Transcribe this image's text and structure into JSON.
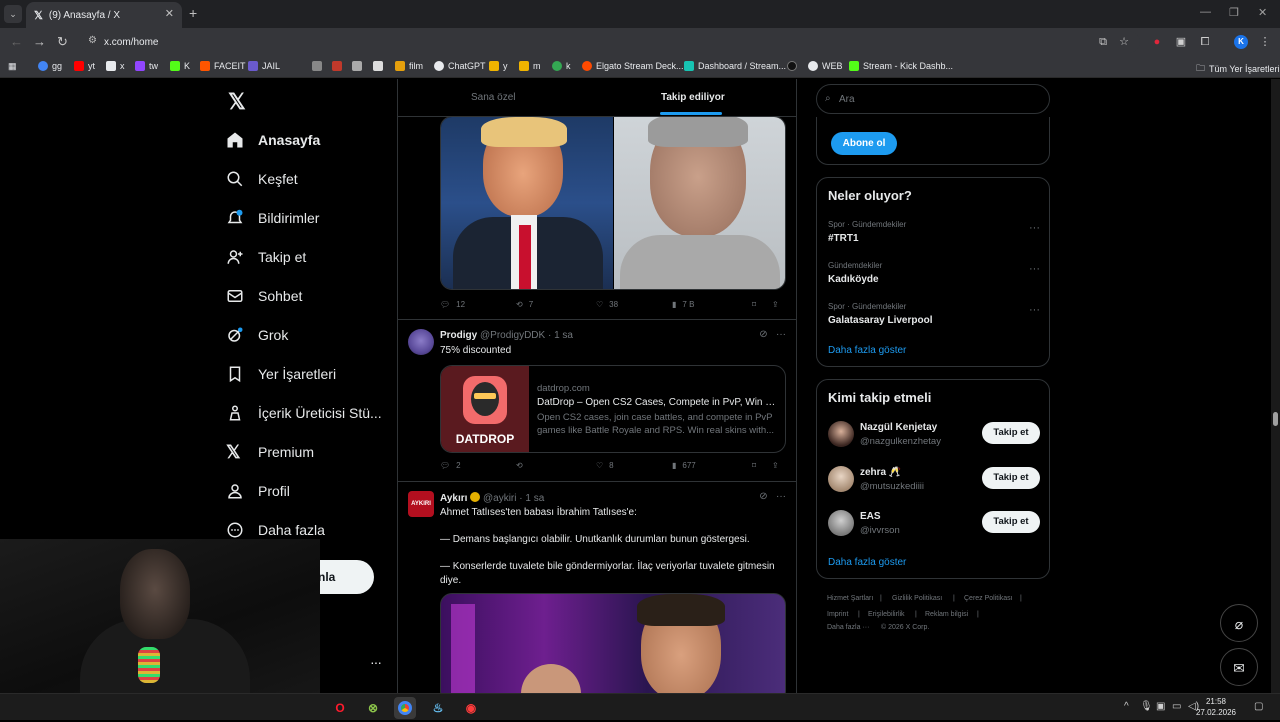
{
  "browser": {
    "tab_title": "(9) Anasayfa / X",
    "url": "x.com/home",
    "bookmarks": [
      {
        "label": "gg",
        "color": "#4285f4"
      },
      {
        "label": "yt",
        "color": "#ff0000"
      },
      {
        "label": "x",
        "color": "#e8eaed"
      },
      {
        "label": "tw",
        "color": "#9146ff"
      },
      {
        "label": "K",
        "color": "#53fc18"
      },
      {
        "label": "FACEIT",
        "color": "#ff5500"
      },
      {
        "label": "JAIL",
        "color": "#6a5acd"
      },
      {
        "label": "film",
        "color": "#e5a00d"
      },
      {
        "label": "ChatGPT",
        "color": "#e8eaed"
      },
      {
        "label": "y",
        "color": "#f0b400"
      },
      {
        "label": "m",
        "color": "#f0b400"
      },
      {
        "label": "k",
        "color": "#34a853"
      },
      {
        "label": "Elgato Stream Deck...",
        "color": "#ff4a00"
      },
      {
        "label": "Dashboard / Stream...",
        "color": "#17c3b2"
      },
      {
        "label": "WEB",
        "color": "#e8eaed"
      },
      {
        "label": "Stream - Kick Dashb...",
        "color": "#53fc18"
      }
    ],
    "all_bookmarks": "Tüm Yer İşaretleri"
  },
  "nav": {
    "items": [
      {
        "label": "Anasayfa",
        "icon": "home-icon"
      },
      {
        "label": "Keşfet",
        "icon": "search-icon"
      },
      {
        "label": "Bildirimler",
        "icon": "bell-icon"
      },
      {
        "label": "Takip et",
        "icon": "add-person-icon"
      },
      {
        "label": "Sohbet",
        "icon": "mail-icon"
      },
      {
        "label": "Grok",
        "icon": "grok-icon"
      },
      {
        "label": "Yer İşaretleri",
        "icon": "bookmark-icon"
      },
      {
        "label": "İçerik Üreticisi Stü...",
        "icon": "creator-icon"
      },
      {
        "label": "Premium",
        "icon": "x-icon"
      },
      {
        "label": "Profil",
        "icon": "person-icon"
      },
      {
        "label": "Daha fazla",
        "icon": "more-circle-icon"
      }
    ],
    "post_label": "nla"
  },
  "timeline": {
    "tabs": [
      "Sana özel",
      "Takip ediliyor"
    ],
    "tweet1": {
      "replies": "12",
      "reposts": "7",
      "likes": "38",
      "views": "7 B"
    },
    "tweet2": {
      "name": "Prodigy",
      "meta": "@ProdigyDDK · 1 sa",
      "text": "75% discounted",
      "card": {
        "logo_text": "DATDROP",
        "domain": "datdrop.com",
        "title": "DatDrop – Open CS2 Cases, Compete in PvP, Win Ski...",
        "desc": "Open CS2 cases, join case battles, and compete in PvP games like Battle Royale and RPS. Win real skins with..."
      },
      "replies": "2",
      "reposts": "",
      "likes": "8",
      "views": "677"
    },
    "tweet3": {
      "avatar_text": "AYKIRI",
      "name": "Aykırı",
      "meta": "@aykiri · 1 sa",
      "line1": "Ahmet Tatlıses'ten babası İbrahim Tatlıses'e:",
      "line2": "— Demans başlangıcı olabilir. Unutkanlık durumları bunun göstergesi.",
      "line3": "— Konserlerde tuvalete bile göndermiyorlar. İlaç veriyorlar tuvalete gitmesin diye."
    }
  },
  "right": {
    "search_placeholder": "Ara",
    "subscribe_label": "Abone ol",
    "trends_title": "Neler oluyor?",
    "trends": [
      {
        "meta": "Spor · Gündemdekiler",
        "name": "#TRT1"
      },
      {
        "meta": "Gündemdekiler",
        "name": "Kadıköyde"
      },
      {
        "meta": "Spor · Gündemdekiler",
        "name": "Galatasaray Liverpool"
      }
    ],
    "show_more": "Daha fazla göster",
    "wtf_title": "Kimi takip etmeli",
    "wtf": [
      {
        "name": "Nazgül Kenjetay",
        "handle": "@nazgulkenzhetay",
        "button": "Takip et"
      },
      {
        "name": "zehra 🥂",
        "handle": "@mutsuzkediiii",
        "button": "Takip et"
      },
      {
        "name": "EAS",
        "handle": "@ivvrson",
        "button": "Takip et"
      }
    ],
    "footer": {
      "l1": "Hizmet Şartları",
      "l2": "Gizlilik Politikası",
      "l3": "Çerez Politikası",
      "l4": "Imprint",
      "l5": "Erişilebilirlik",
      "l6": "Reklam bilgisi",
      "l7": "Daha fazla ···",
      "l8": "© 2026 X Corp."
    }
  },
  "taskbar": {
    "time": "21:58",
    "date": "27.02.2026"
  },
  "colors": {
    "accent": "#1d9bf0",
    "bg": "#000000",
    "border": "#2f3336"
  }
}
